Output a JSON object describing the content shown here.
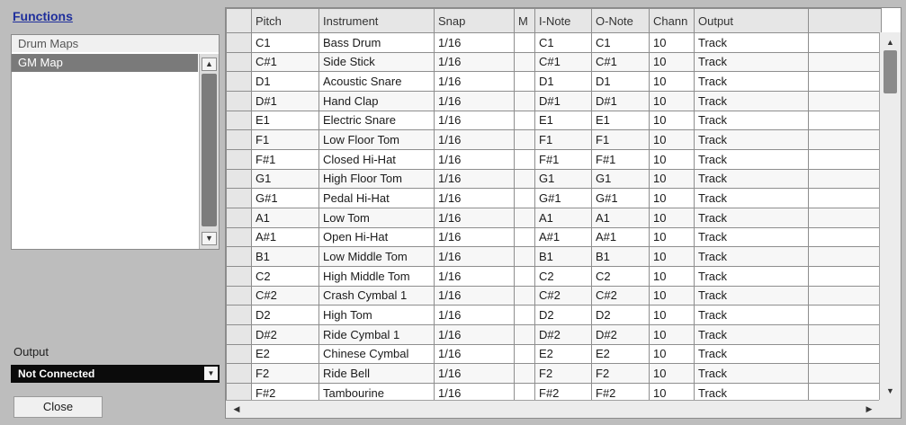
{
  "functions_label": "Functions",
  "drum_maps": {
    "header": "Drum Maps",
    "selected": "GM Map"
  },
  "output_label": "Output",
  "output_value": "Not Connected",
  "close_label": "Close",
  "table": {
    "columns": [
      "",
      "Pitch",
      "Instrument",
      "Snap",
      "M",
      "I-Note",
      "O-Note",
      "Chann",
      "Output",
      ""
    ],
    "rows": [
      [
        "C1",
        "Bass Drum",
        "1/16",
        "",
        "C1",
        "C1",
        "10",
        "Track"
      ],
      [
        "C#1",
        "Side Stick",
        "1/16",
        "",
        "C#1",
        "C#1",
        "10",
        "Track"
      ],
      [
        "D1",
        "Acoustic Snare",
        "1/16",
        "",
        "D1",
        "D1",
        "10",
        "Track"
      ],
      [
        "D#1",
        "Hand Clap",
        "1/16",
        "",
        "D#1",
        "D#1",
        "10",
        "Track"
      ],
      [
        "E1",
        "Electric Snare",
        "1/16",
        "",
        "E1",
        "E1",
        "10",
        "Track"
      ],
      [
        "F1",
        "Low Floor Tom",
        "1/16",
        "",
        "F1",
        "F1",
        "10",
        "Track"
      ],
      [
        "F#1",
        "Closed Hi-Hat",
        "1/16",
        "",
        "F#1",
        "F#1",
        "10",
        "Track"
      ],
      [
        "G1",
        "High Floor Tom",
        "1/16",
        "",
        "G1",
        "G1",
        "10",
        "Track"
      ],
      [
        "G#1",
        "Pedal Hi-Hat",
        "1/16",
        "",
        "G#1",
        "G#1",
        "10",
        "Track"
      ],
      [
        "A1",
        "Low Tom",
        "1/16",
        "",
        "A1",
        "A1",
        "10",
        "Track"
      ],
      [
        "A#1",
        "Open Hi-Hat",
        "1/16",
        "",
        "A#1",
        "A#1",
        "10",
        "Track"
      ],
      [
        "B1",
        "Low Middle Tom",
        "1/16",
        "",
        "B1",
        "B1",
        "10",
        "Track"
      ],
      [
        "C2",
        "High Middle Tom",
        "1/16",
        "",
        "C2",
        "C2",
        "10",
        "Track"
      ],
      [
        "C#2",
        "Crash Cymbal 1",
        "1/16",
        "",
        "C#2",
        "C#2",
        "10",
        "Track"
      ],
      [
        "D2",
        "High Tom",
        "1/16",
        "",
        "D2",
        "D2",
        "10",
        "Track"
      ],
      [
        "D#2",
        "Ride Cymbal 1",
        "1/16",
        "",
        "D#2",
        "D#2",
        "10",
        "Track"
      ],
      [
        "E2",
        "Chinese Cymbal",
        "1/16",
        "",
        "E2",
        "E2",
        "10",
        "Track"
      ],
      [
        "F2",
        "Ride Bell",
        "1/16",
        "",
        "F2",
        "F2",
        "10",
        "Track"
      ],
      [
        "F#2",
        "Tambourine",
        "1/16",
        "",
        "F#2",
        "F#2",
        "10",
        "Track"
      ]
    ]
  },
  "icons": {
    "scroll_up": "▲",
    "scroll_down": "▼",
    "scroll_left": "◀",
    "scroll_right": "▶",
    "dropdown": "▼"
  }
}
